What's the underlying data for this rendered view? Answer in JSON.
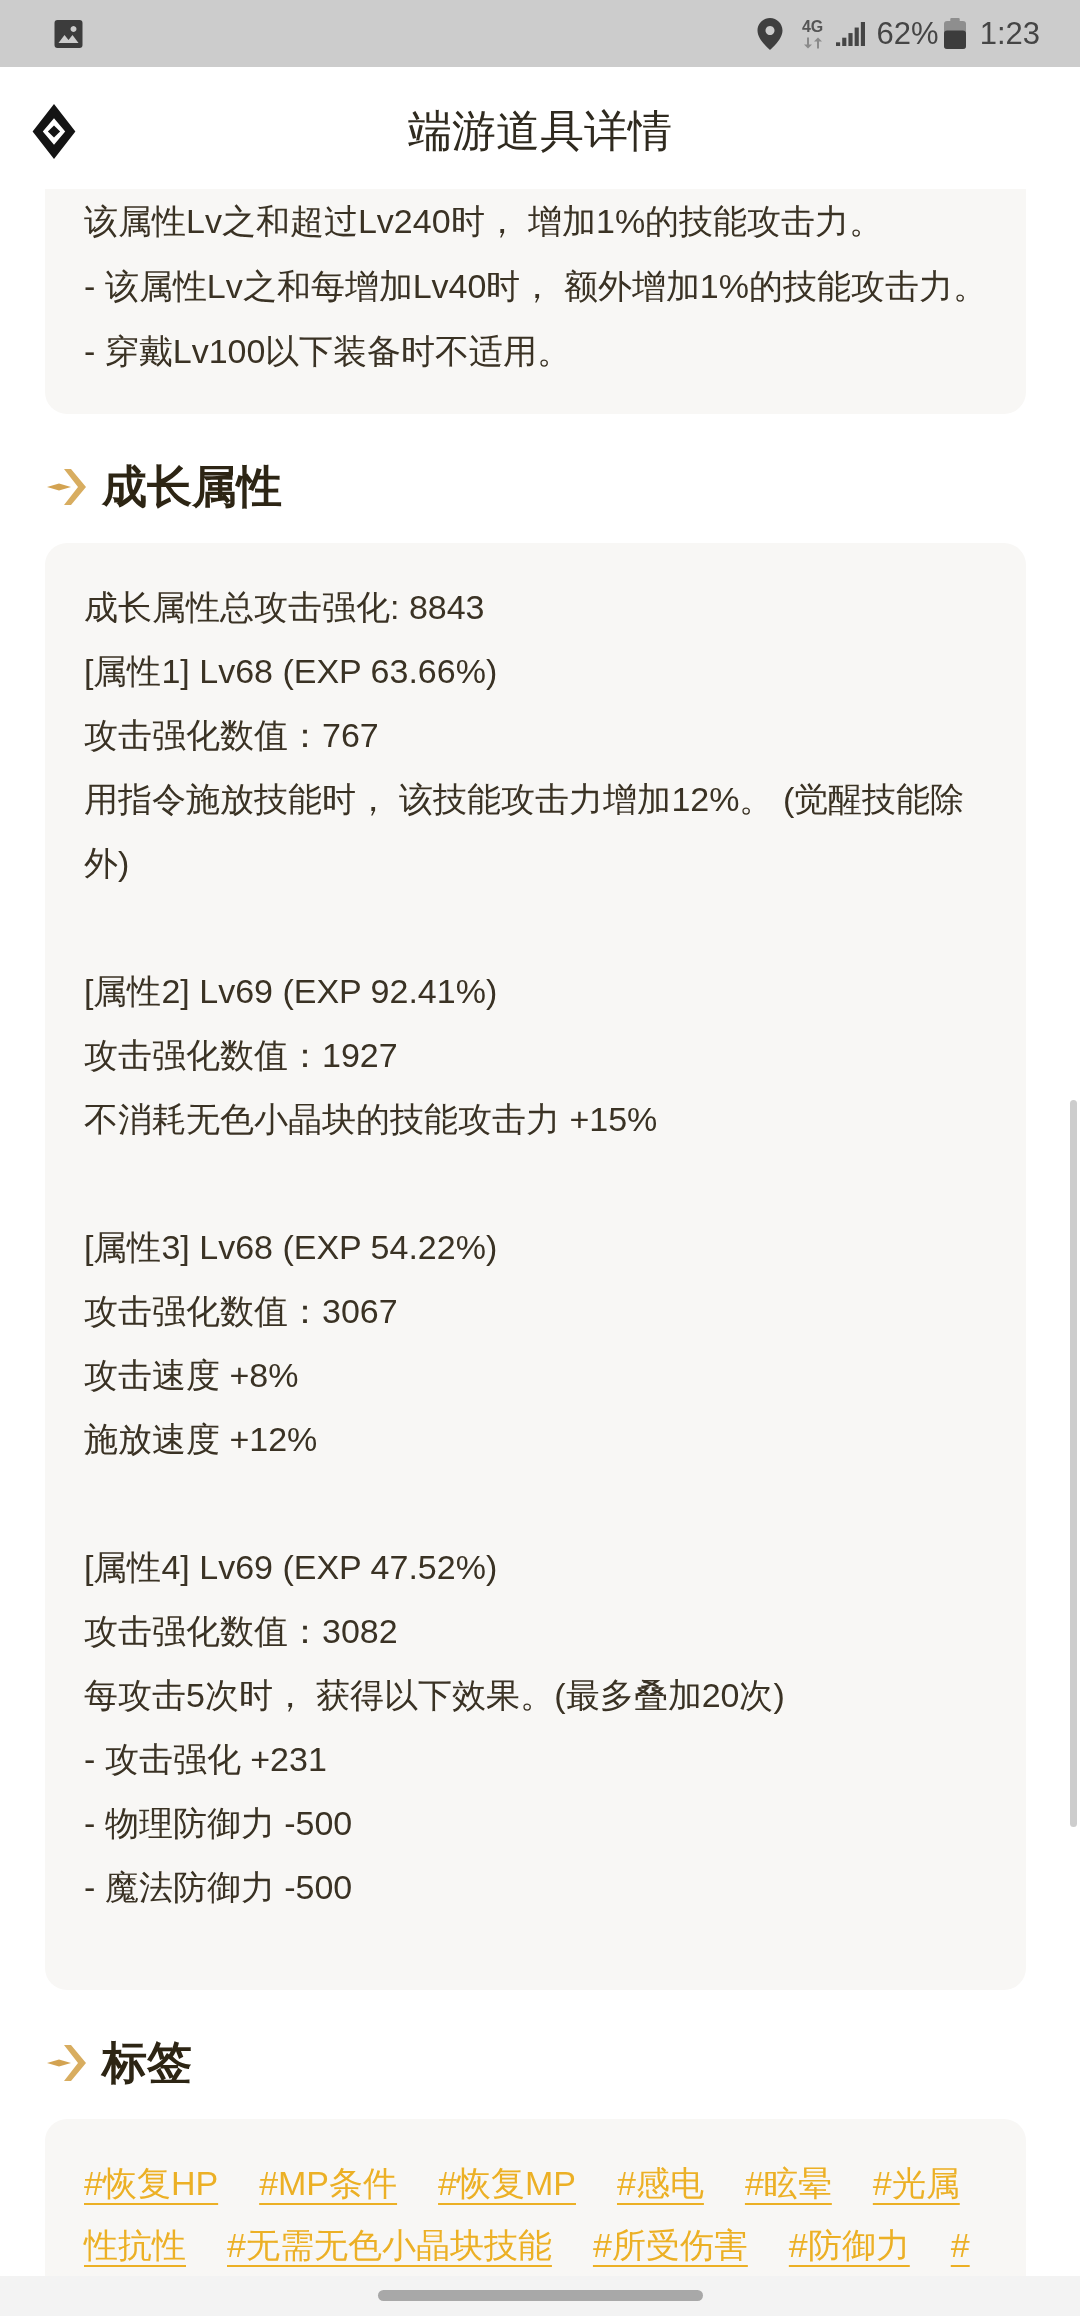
{
  "status_bar": {
    "network": "4G",
    "battery": "62%",
    "time": "1:23"
  },
  "header": {
    "title": "端游道具详情"
  },
  "intro_card": {
    "lines": [
      "该属性Lv之和超过Lv240时， 增加1%的技能攻击力。",
      "- 该属性Lv之和每增加Lv40时， 额外增加1%的技能攻击力。",
      "- 穿戴Lv100以下装备时不适用。"
    ]
  },
  "sections": [
    {
      "kind": "text",
      "title": "成长属性",
      "groups": [
        [
          "成长属性总攻击强化: 8843",
          "[属性1] Lv68 (EXP 63.66%)",
          "攻击强化数值：767",
          "用指令施放技能时， 该技能攻击力增加12%。 (觉醒技能除外)"
        ],
        [
          "[属性2] Lv69 (EXP 92.41%)",
          "攻击强化数值：1927",
          "不消耗无色小晶块的技能攻击力 +15%"
        ],
        [
          "[属性3] Lv68 (EXP 54.22%)",
          "攻击强化数值：3067",
          "攻击速度 +8%",
          "施放速度 +12%"
        ],
        [
          "[属性4] Lv69 (EXP 47.52%)",
          "攻击强化数值：3082",
          "每攻击5次时， 获得以下效果。(最多叠加20次)",
          "- 攻击强化 +231",
          "- 物理防御力 -500",
          "- 魔法防御力 -500"
        ]
      ]
    },
    {
      "kind": "tags",
      "title": "标签",
      "tags": [
        "#恢复HP",
        "#MP条件",
        "#恢复MP",
        "#感电",
        "#眩晕",
        "#光属",
        "性抗性",
        "#无需无色小晶块技能",
        "#所受伤害",
        "#防御力",
        "#"
      ]
    }
  ]
}
